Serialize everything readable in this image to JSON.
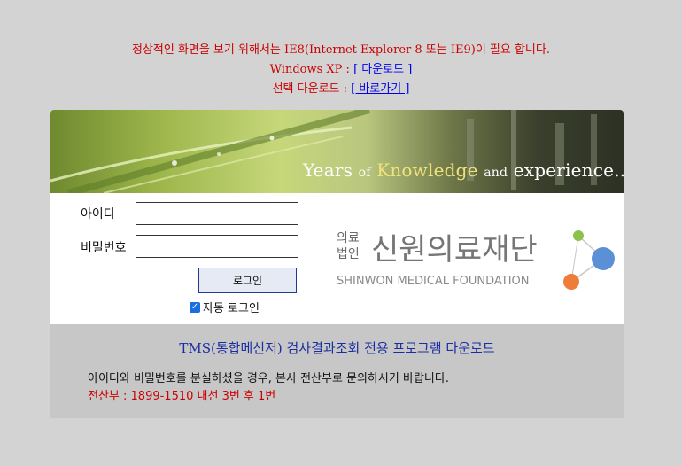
{
  "notice": {
    "line1": "정상적인 화면을 보기 위해서는 IE8(Internet Explorer 8 또는 IE9)이 필요 합니다.",
    "line2_prefix": "Windows XP : ",
    "line2_link": "[ 다운로드 ]",
    "line3_prefix": "선택 다운로드 : ",
    "line3_link": "[ 바로가기 ]"
  },
  "banner": {
    "text_years": "Years",
    "text_of": "of",
    "text_knowledge": "Knowledge",
    "text_and": "and",
    "text_experience": "experience..."
  },
  "login": {
    "id_label": "아이디",
    "pw_label": "비밀번호",
    "id_value": "",
    "pw_value": "",
    "login_button": "로그인",
    "auto_login_label": "자동 로그인",
    "auto_login_checked": true
  },
  "logo": {
    "corp_line1": "의료",
    "corp_line2": "법인",
    "name": "신원의료재단",
    "english": "SHINWON MEDICAL FOUNDATION",
    "colors": {
      "green": "#8bc34a",
      "blue": "#5b8fd6",
      "orange": "#f07c3a"
    }
  },
  "footer": {
    "title": "TMS(통합메신저) 검사결과조회 전용 프로그램 다운로드",
    "line1": "아이디와 비밀번호를 분실하셨을 경우, 본사 전산부로 문의하시기 바랍니다.",
    "line2": "전산부 : 1899-1510 내선 3번 후 1번"
  }
}
